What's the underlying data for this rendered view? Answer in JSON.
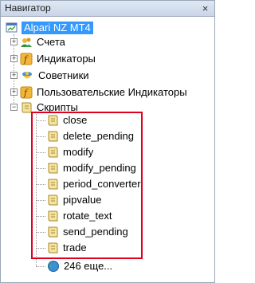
{
  "title": "Навигатор",
  "root": {
    "label": "Alpari NZ MT4",
    "icon": "terminal-icon"
  },
  "nodes": [
    {
      "label": "Счета",
      "icon": "accounts-icon"
    },
    {
      "label": "Индикаторы",
      "icon": "indicators-icon"
    },
    {
      "label": "Советники",
      "icon": "experts-icon"
    },
    {
      "label": "Пользовательские Индикаторы",
      "icon": "custom-indicators-icon"
    },
    {
      "label": "Скрипты",
      "icon": "scripts-icon",
      "expanded": true
    }
  ],
  "scripts": [
    "close",
    "delete_pending",
    "modify",
    "modify_pending",
    "period_converter",
    "pipvalue",
    "rotate_text",
    "send_pending",
    "trade"
  ],
  "more": {
    "label": "246 еще...",
    "icon": "globe-icon"
  },
  "colors": {
    "selection": "#3399ff",
    "highlight_border": "#e0001b",
    "titlebar": "#d3deee"
  }
}
